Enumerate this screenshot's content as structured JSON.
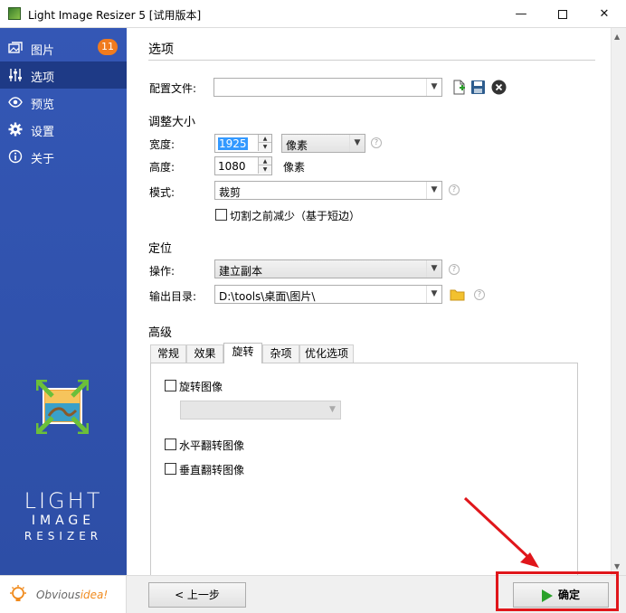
{
  "window": {
    "title": "Light Image Resizer 5  [试用版本]",
    "min_glyph": "—",
    "close_glyph": "✕"
  },
  "sidebar": {
    "items": [
      {
        "label": "图片",
        "badge": "11",
        "icon": "images-icon"
      },
      {
        "label": "选项",
        "icon": "sliders-icon",
        "active": true
      },
      {
        "label": "预览",
        "icon": "eye-icon"
      },
      {
        "label": "设置",
        "icon": "gear-icon"
      },
      {
        "label": "关于",
        "icon": "info-icon"
      }
    ],
    "logo": {
      "line1": "LIGHT",
      "line2": "IMAGE",
      "line3": "RESIZER"
    },
    "brand": {
      "prefix": "Obvious",
      "accent": "idea!"
    }
  },
  "main": {
    "page_title": "选项",
    "profile_label": "配置文件:",
    "profile_value": "",
    "resize": {
      "heading": "调整大小",
      "width_label": "宽度:",
      "width_value": "1925",
      "unit_value": "像素",
      "height_label": "高度:",
      "height_value": "1080",
      "height_unit": "像素",
      "mode_label": "模式:",
      "mode_value": "裁剪",
      "reduce_before_crop_label": "切割之前减少（基于短边）"
    },
    "position": {
      "heading": "定位",
      "action_label": "操作:",
      "action_value": "建立副本",
      "output_label": "输出目录:",
      "output_value": "D:\\tools\\桌面\\图片\\"
    },
    "advanced": {
      "heading": "高级",
      "tabs": [
        "常规",
        "效果",
        "旋转",
        "杂项",
        "优化选项"
      ],
      "active_tab": "旋转",
      "rotate_label": "旋转图像",
      "flip_h_label": "水平翻转图像",
      "flip_v_label": "垂直翻转图像"
    }
  },
  "footer": {
    "prev_label": "< 上一步",
    "ok_label": "确定"
  },
  "colors": {
    "sidebar": "#2d4ea6",
    "sidebar_active": "#1e3a86",
    "badge": "#f07b1f",
    "highlight": "#e0161b"
  }
}
